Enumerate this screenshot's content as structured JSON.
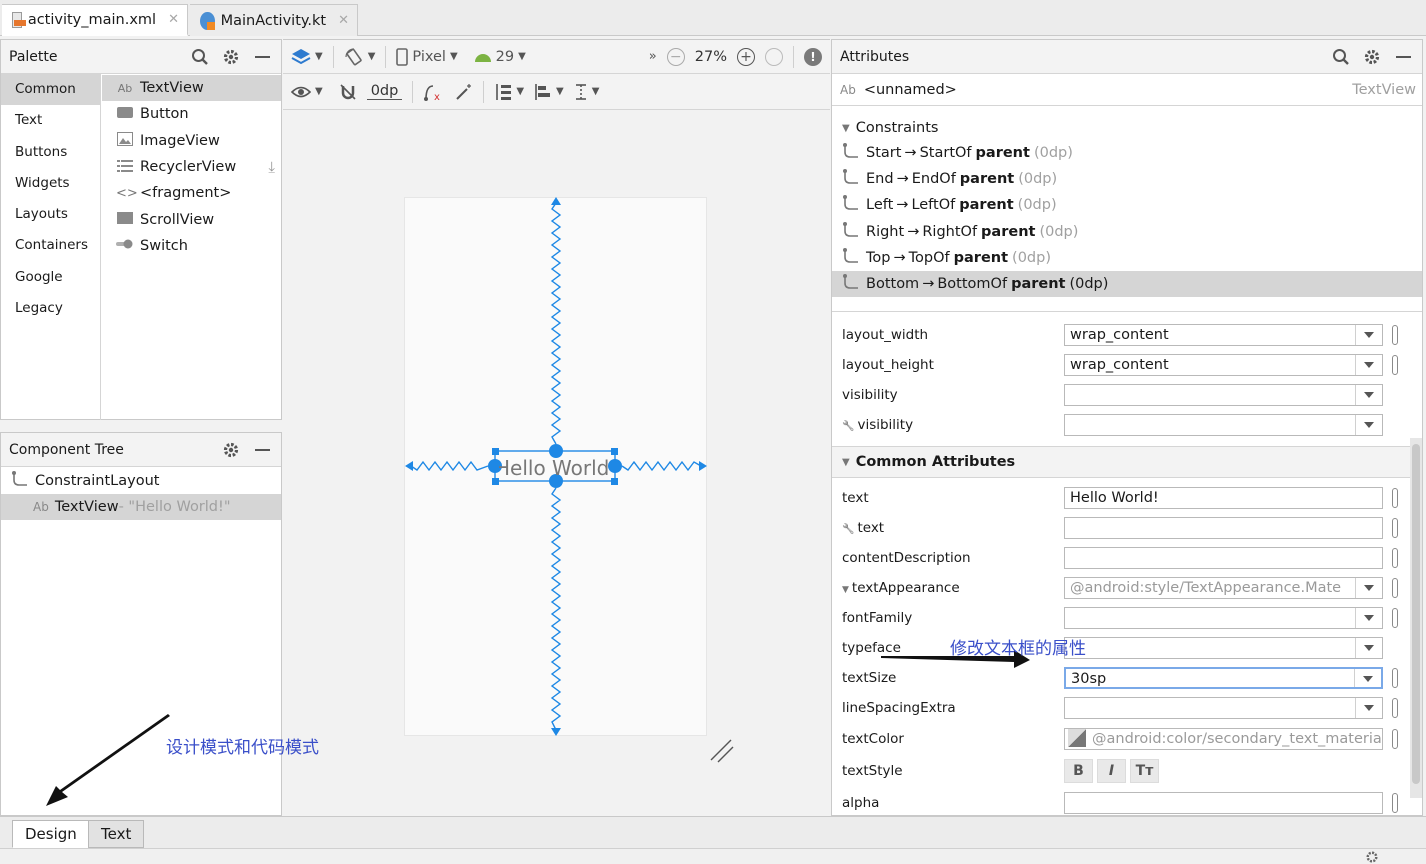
{
  "file_tabs": [
    {
      "label": "activity_main.xml",
      "icon": "xml-file-icon",
      "active": true
    },
    {
      "label": "MainActivity.kt",
      "icon": "kotlin-file-icon",
      "active": false
    }
  ],
  "palette": {
    "title": "Palette",
    "categories": [
      "Common",
      "Text",
      "Buttons",
      "Widgets",
      "Layouts",
      "Containers",
      "Google",
      "Legacy"
    ],
    "items": [
      {
        "label": "TextView",
        "icon": "Ab"
      },
      {
        "label": "Button",
        "icon": ""
      },
      {
        "label": "ImageView",
        "icon": ""
      },
      {
        "label": "RecyclerView",
        "icon": ""
      },
      {
        "label": "<fragment>",
        "icon": "<>"
      },
      {
        "label": "ScrollView",
        "icon": ""
      },
      {
        "label": "Switch",
        "icon": ""
      }
    ]
  },
  "component_tree": {
    "title": "Component Tree",
    "root": "ConstraintLayout",
    "child_label": "TextView",
    "child_text": "- \"Hello World!\"",
    "child_icon": "Ab"
  },
  "design_toolbar": {
    "device": "Pixel",
    "api": "29",
    "zoom": "27%",
    "margin": "0dp"
  },
  "canvas": {
    "text": "Hello World!"
  },
  "attributes": {
    "title": "Attributes",
    "id_icon": "Ab",
    "id": "<unnamed>",
    "type": "TextView",
    "constraints_title": "Constraints",
    "constraints": [
      {
        "side": "Start",
        "target": "StartOf",
        "parent": "parent",
        "margin": "(0dp)"
      },
      {
        "side": "End",
        "target": "EndOf",
        "parent": "parent",
        "margin": "(0dp)"
      },
      {
        "side": "Left",
        "target": "LeftOf",
        "parent": "parent",
        "margin": "(0dp)"
      },
      {
        "side": "Right",
        "target": "RightOf",
        "parent": "parent",
        "margin": "(0dp)"
      },
      {
        "side": "Top",
        "target": "TopOf",
        "parent": "parent",
        "margin": "(0dp)"
      },
      {
        "side": "Bottom",
        "target": "BottomOf",
        "parent": "parent",
        "margin": "(0dp)"
      }
    ],
    "layout": [
      {
        "label": "layout_width",
        "value": "wrap_content"
      },
      {
        "label": "layout_height",
        "value": "wrap_content"
      },
      {
        "label": "visibility",
        "value": ""
      },
      {
        "label": "visibility",
        "value": ""
      }
    ],
    "common_title": "Common Attributes",
    "common": [
      {
        "label": "text",
        "value": "Hello World!"
      },
      {
        "label": "text",
        "value": ""
      },
      {
        "label": "contentDescription",
        "value": ""
      },
      {
        "label": "textAppearance",
        "value": "@android:style/TextAppearance.Mate"
      },
      {
        "label": "fontFamily",
        "value": ""
      },
      {
        "label": "typeface",
        "value": ""
      },
      {
        "label": "textSize",
        "value": "30sp"
      },
      {
        "label": "lineSpacingExtra",
        "value": ""
      },
      {
        "label": "textColor",
        "value": "@android:color/secondary_text_materia"
      },
      {
        "label": "textStyle",
        "value": ""
      },
      {
        "label": "alpha",
        "value": ""
      }
    ],
    "style_buttons": [
      "B",
      "I",
      "Tт"
    ]
  },
  "bottom_tabs": [
    "Design",
    "Text"
  ],
  "annotations": {
    "attr_note": "修改文本框的属性",
    "mode_note": "设计模式和代码模式"
  },
  "colors": {
    "accent": "#1e88e5",
    "annotation": "#3a4fc9"
  }
}
